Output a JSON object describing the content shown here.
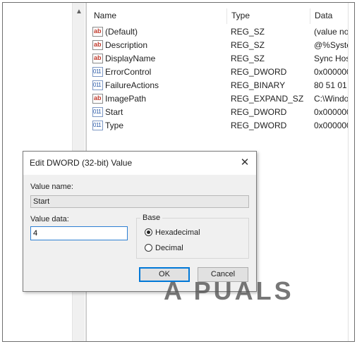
{
  "list": {
    "columns": {
      "name": "Name",
      "type": "Type",
      "data": "Data"
    },
    "rows": [
      {
        "icon": "string-value-icon",
        "glyph": "ab",
        "name": "(Default)",
        "type": "REG_SZ",
        "data": "(value no"
      },
      {
        "icon": "string-value-icon",
        "glyph": "ab",
        "name": "Description",
        "type": "REG_SZ",
        "data": "@%Syste"
      },
      {
        "icon": "string-value-icon",
        "glyph": "ab",
        "name": "DisplayName",
        "type": "REG_SZ",
        "data": "Sync Hos"
      },
      {
        "icon": "binary-value-icon",
        "glyph": "011",
        "name": "ErrorControl",
        "type": "REG_DWORD",
        "data": "0x000000"
      },
      {
        "icon": "binary-value-icon",
        "glyph": "011",
        "name": "FailureActions",
        "type": "REG_BINARY",
        "data": "80 51 01 0"
      },
      {
        "icon": "string-value-icon",
        "glyph": "ab",
        "name": "ImagePath",
        "type": "REG_EXPAND_SZ",
        "data": "C:\\Windo"
      },
      {
        "icon": "binary-value-icon",
        "glyph": "011",
        "name": "Start",
        "type": "REG_DWORD",
        "data": "0x000000"
      },
      {
        "icon": "binary-value-icon",
        "glyph": "011",
        "name": "Type",
        "type": "REG_DWORD",
        "data": "0x000000"
      }
    ]
  },
  "dialog": {
    "title": "Edit DWORD (32-bit) Value",
    "close_glyph": "✕",
    "value_name_label": "Value name:",
    "value_name": "Start",
    "value_data_label": "Value data:",
    "value_data": "4",
    "base_label": "Base",
    "radio_hex": "Hexadecimal",
    "radio_dec": "Decimal",
    "ok_label": "OK",
    "cancel_label": "Cancel"
  },
  "watermark": {
    "text": "A PUALS"
  }
}
